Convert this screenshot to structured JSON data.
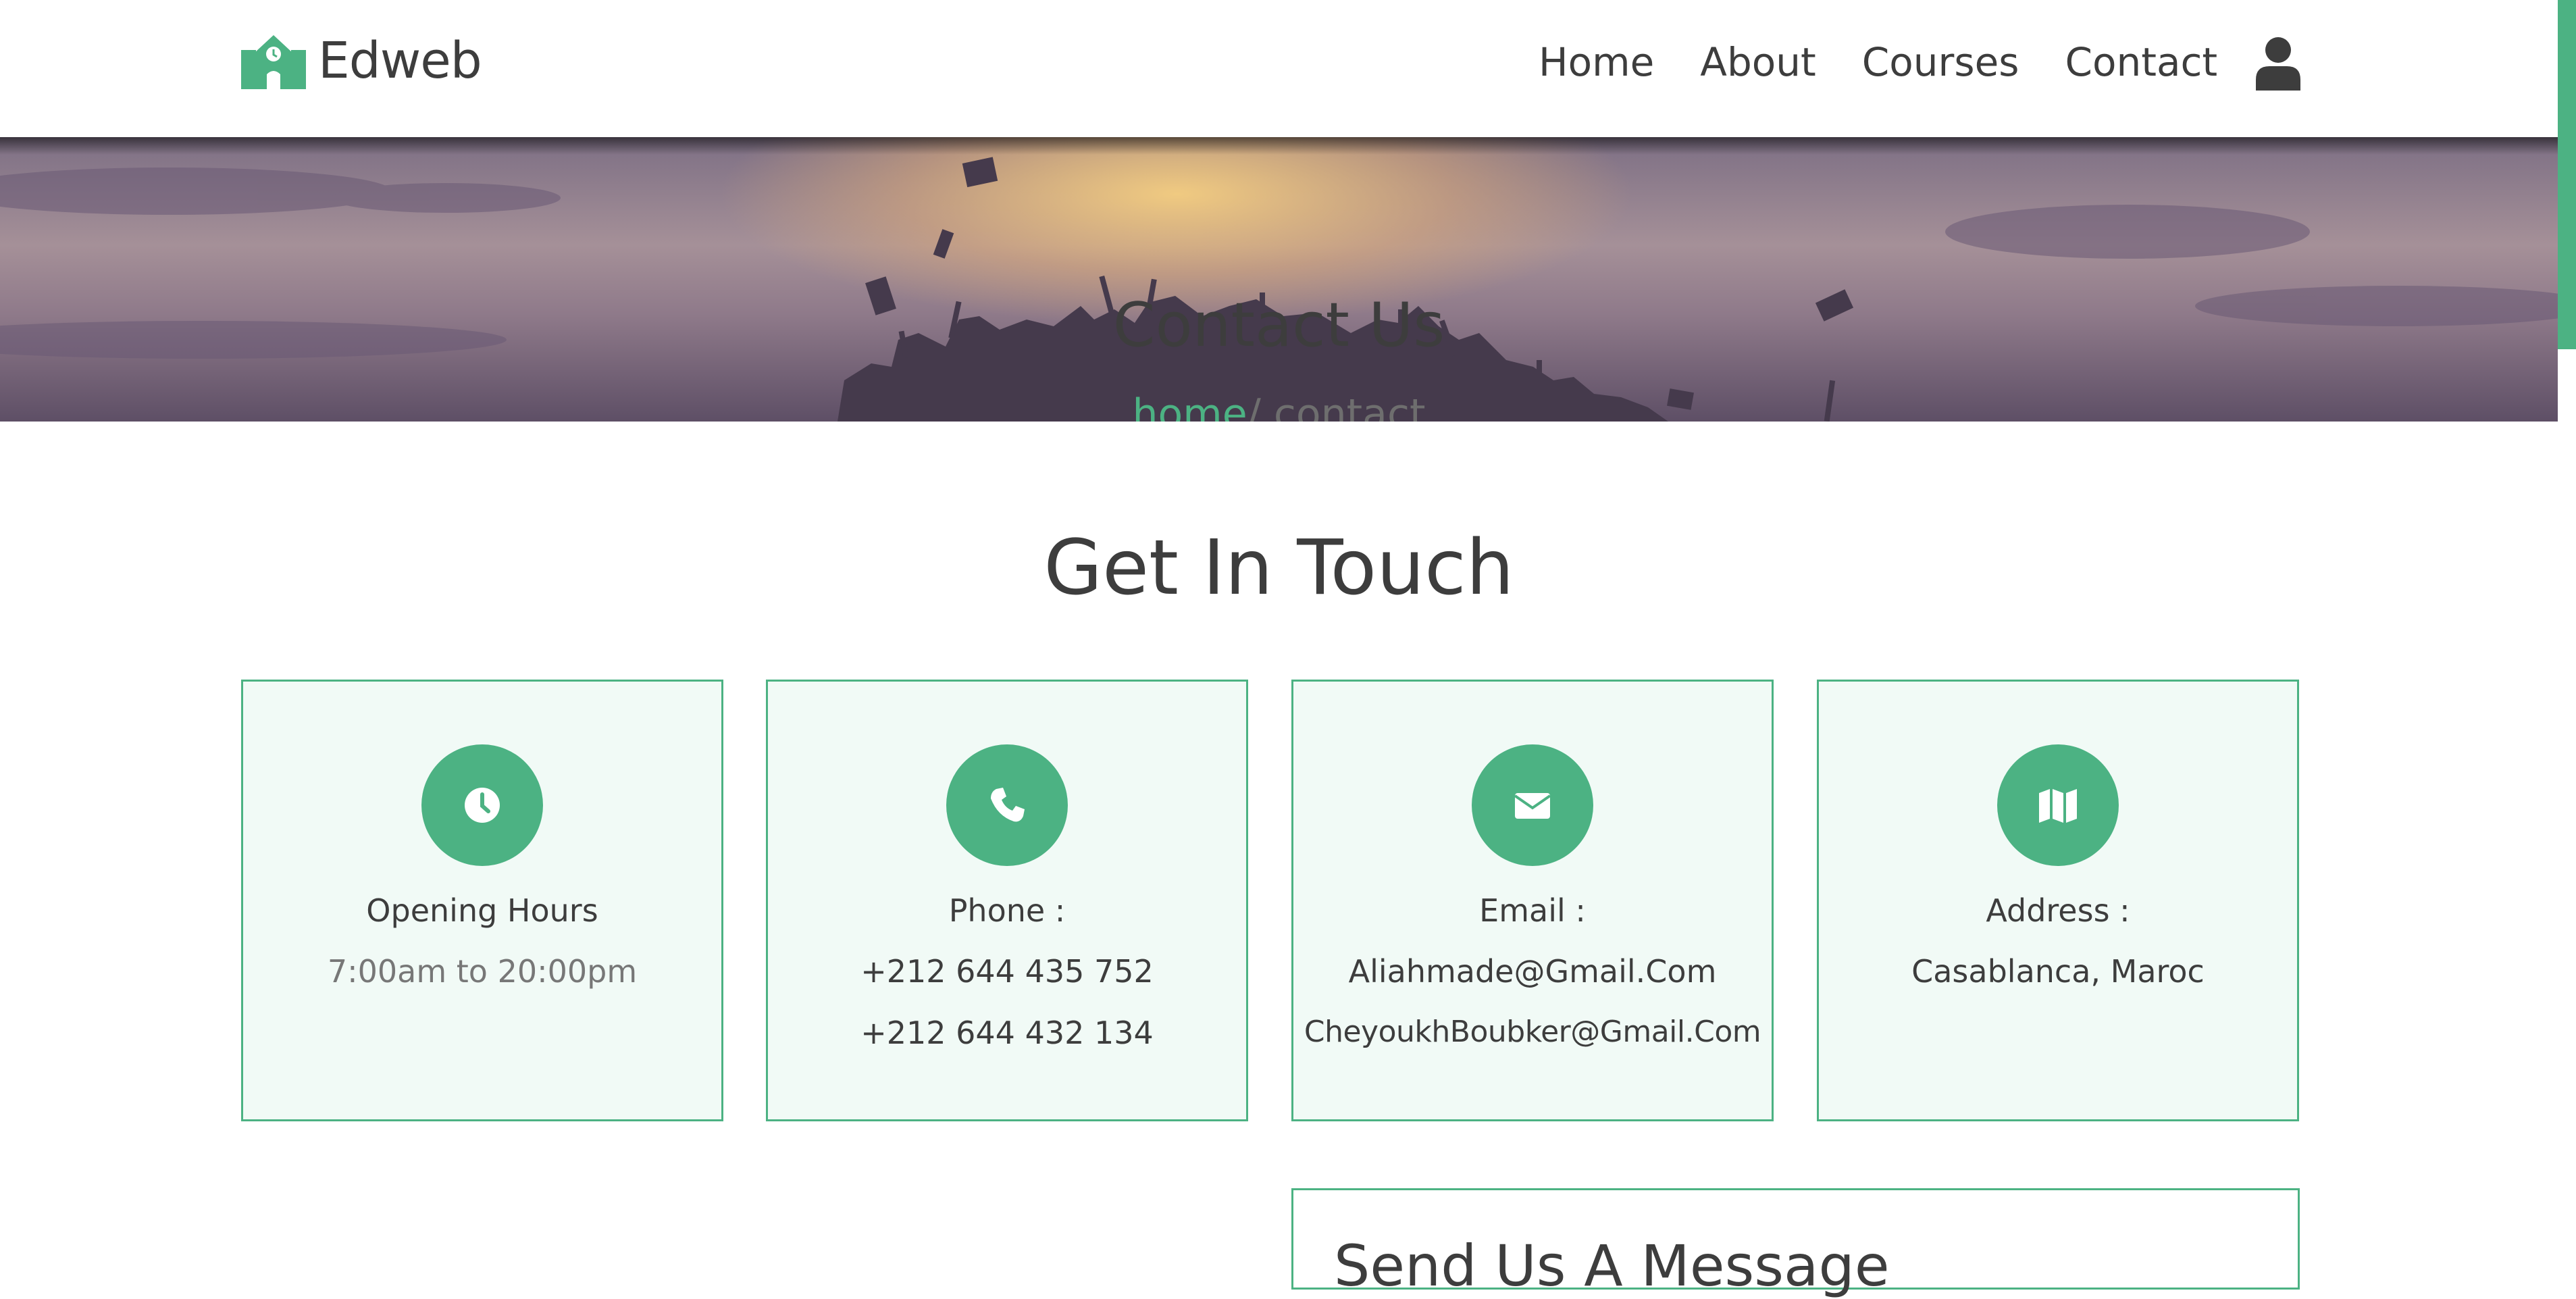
{
  "header": {
    "brand": "Edweb",
    "nav": [
      "Home",
      "About",
      "Courses",
      "Contact"
    ]
  },
  "hero": {
    "title": "Contact Us",
    "breadcrumb": {
      "home": "home",
      "separator": "/",
      "current": " contact"
    }
  },
  "section": {
    "title": "Get In Touch"
  },
  "cards": [
    {
      "icon": "clock-icon",
      "label": "Opening Hours",
      "lines": [
        "7:00am to 20:00pm"
      ]
    },
    {
      "icon": "phone-icon",
      "label": "Phone :",
      "lines": [
        "+212 644 435 752",
        "+212 644 432 134"
      ]
    },
    {
      "icon": "envelope-icon",
      "label": "Email :",
      "lines": [
        "Aliahmade@Gmail.Com",
        "CheyoukhBoubker@Gmail.Com"
      ]
    },
    {
      "icon": "map-icon",
      "label": "Address :",
      "lines": [
        "Casablanca, Maroc"
      ]
    }
  ],
  "message_form": {
    "title": "Send Us A Message"
  },
  "colors": {
    "accent": "#4cb283",
    "text": "#3d3d3d",
    "card_bg": "#f1faf6"
  }
}
